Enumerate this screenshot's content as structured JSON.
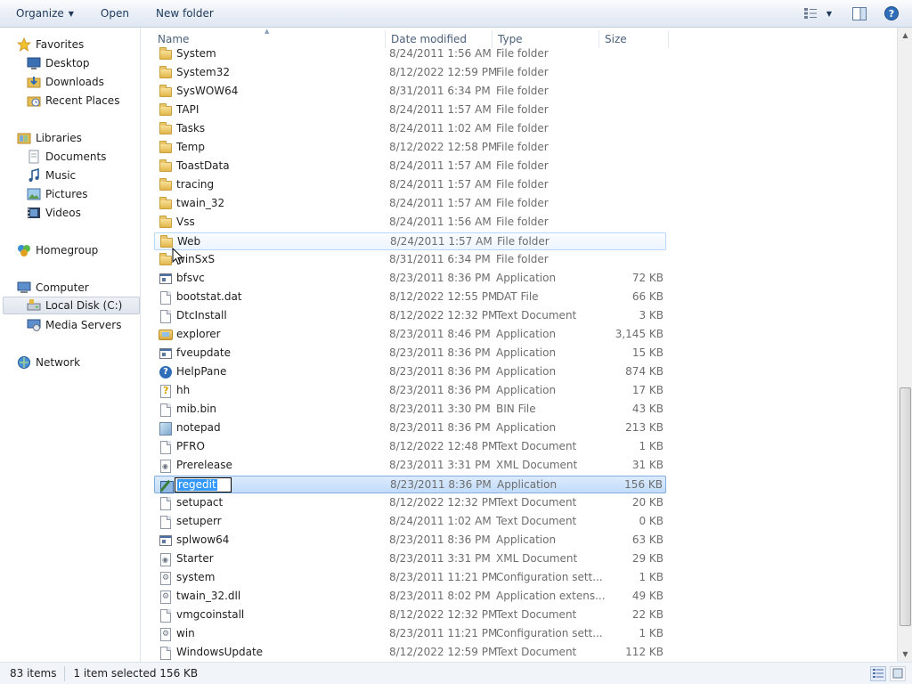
{
  "toolbar": {
    "organize_label": "Organize",
    "open_label": "Open",
    "new_folder_label": "New folder",
    "icons": [
      "views-icon",
      "chevron-down-icon",
      "preview-pane-icon",
      "help-icon"
    ]
  },
  "nav": {
    "favorites": "Favorites",
    "desktop": "Desktop",
    "downloads": "Downloads",
    "recent_places": "Recent Places",
    "libraries": "Libraries",
    "documents": "Documents",
    "music": "Music",
    "pictures": "Pictures",
    "videos": "Videos",
    "homegroup": "Homegroup",
    "computer": "Computer",
    "local_disk": "Local Disk (C:)",
    "media_servers": "Media Servers",
    "network": "Network"
  },
  "columns": {
    "name": "Name",
    "date_modified": "Date modified",
    "type": "Type",
    "size": "Size"
  },
  "rows": [
    {
      "name": "System",
      "date": "8/24/2011 1:56 AM",
      "type": "File folder",
      "size": "",
      "icon": "folder-icon"
    },
    {
      "name": "System32",
      "date": "8/12/2022 12:59 PM",
      "type": "File folder",
      "size": "",
      "icon": "folder-icon"
    },
    {
      "name": "SysWOW64",
      "date": "8/31/2011 6:34 PM",
      "type": "File folder",
      "size": "",
      "icon": "folder-icon"
    },
    {
      "name": "TAPI",
      "date": "8/24/2011 1:57 AM",
      "type": "File folder",
      "size": "",
      "icon": "folder-icon"
    },
    {
      "name": "Tasks",
      "date": "8/24/2011 1:02 AM",
      "type": "File folder",
      "size": "",
      "icon": "folder-icon"
    },
    {
      "name": "Temp",
      "date": "8/12/2022 12:58 PM",
      "type": "File folder",
      "size": "",
      "icon": "folder-icon"
    },
    {
      "name": "ToastData",
      "date": "8/24/2011 1:57 AM",
      "type": "File folder",
      "size": "",
      "icon": "folder-icon"
    },
    {
      "name": "tracing",
      "date": "8/24/2011 1:57 AM",
      "type": "File folder",
      "size": "",
      "icon": "folder-icon"
    },
    {
      "name": "twain_32",
      "date": "8/24/2011 1:57 AM",
      "type": "File folder",
      "size": "",
      "icon": "folder-icon"
    },
    {
      "name": "Vss",
      "date": "8/24/2011 1:56 AM",
      "type": "File folder",
      "size": "",
      "icon": "folder-icon"
    },
    {
      "name": "Web",
      "date": "8/24/2011 1:57 AM",
      "type": "File folder",
      "size": "",
      "icon": "folder-icon",
      "state": "hover"
    },
    {
      "name": "winSxS",
      "date": "8/31/2011 6:34 PM",
      "type": "File folder",
      "size": "",
      "icon": "folder-icon"
    },
    {
      "name": "bfsvc",
      "date": "8/23/2011 8:36 PM",
      "type": "Application",
      "size": "72 KB",
      "icon": "application-icon"
    },
    {
      "name": "bootstat.dat",
      "date": "8/12/2022 12:55 PM",
      "type": "DAT File",
      "size": "66 KB",
      "icon": "file-icon"
    },
    {
      "name": "DtcInstall",
      "date": "8/12/2022 12:32 PM",
      "type": "Text Document",
      "size": "3 KB",
      "icon": "text-file-icon"
    },
    {
      "name": "explorer",
      "date": "8/23/2011 8:46 PM",
      "type": "Application",
      "size": "3,145 KB",
      "icon": "explorer-icon"
    },
    {
      "name": "fveupdate",
      "date": "8/23/2011 8:36 PM",
      "type": "Application",
      "size": "15 KB",
      "icon": "application-icon"
    },
    {
      "name": "HelpPane",
      "date": "8/23/2011 8:36 PM",
      "type": "Application",
      "size": "874 KB",
      "icon": "help-icon"
    },
    {
      "name": "hh",
      "date": "8/23/2011 8:36 PM",
      "type": "Application",
      "size": "17 KB",
      "icon": "help-file-icon"
    },
    {
      "name": "mib.bin",
      "date": "8/23/2011 3:30 PM",
      "type": "BIN File",
      "size": "43 KB",
      "icon": "file-icon"
    },
    {
      "name": "notepad",
      "date": "8/23/2011 8:36 PM",
      "type": "Application",
      "size": "213 KB",
      "icon": "notepad-icon"
    },
    {
      "name": "PFRO",
      "date": "8/12/2022 12:48 PM",
      "type": "Text Document",
      "size": "1 KB",
      "icon": "text-file-icon"
    },
    {
      "name": "Prerelease",
      "date": "8/23/2011 3:31 PM",
      "type": "XML Document",
      "size": "31 KB",
      "icon": "xml-file-icon"
    },
    {
      "name": "regedit",
      "date": "8/23/2011 8:36 PM",
      "type": "Application",
      "size": "156 KB",
      "icon": "regedit-icon",
      "state": "selected-renaming"
    },
    {
      "name": "setupact",
      "date": "8/12/2022 12:32 PM",
      "type": "Text Document",
      "size": "20 KB",
      "icon": "text-file-icon"
    },
    {
      "name": "setuperr",
      "date": "8/24/2011 1:02 AM",
      "type": "Text Document",
      "size": "0 KB",
      "icon": "text-file-icon"
    },
    {
      "name": "splwow64",
      "date": "8/23/2011 8:36 PM",
      "type": "Application",
      "size": "63 KB",
      "icon": "application-icon"
    },
    {
      "name": "Starter",
      "date": "8/23/2011 3:31 PM",
      "type": "XML Document",
      "size": "29 KB",
      "icon": "xml-file-icon"
    },
    {
      "name": "system",
      "date": "8/23/2011 11:21 PM",
      "type": "Configuration sett...",
      "size": "1 KB",
      "icon": "config-file-icon"
    },
    {
      "name": "twain_32.dll",
      "date": "8/23/2011 8:02 PM",
      "type": "Application extens...",
      "size": "49 KB",
      "icon": "config-file-icon"
    },
    {
      "name": "vmgcoinstall",
      "date": "8/12/2022 12:32 PM",
      "type": "Text Document",
      "size": "22 KB",
      "icon": "text-file-icon"
    },
    {
      "name": "win",
      "date": "8/23/2011 11:21 PM",
      "type": "Configuration sett...",
      "size": "1 KB",
      "icon": "config-file-icon"
    },
    {
      "name": "WindowsUpdate",
      "date": "8/12/2022 12:59 PM",
      "type": "Text Document",
      "size": "112 KB",
      "icon": "text-file-icon"
    }
  ],
  "status": {
    "item_count": "83 items",
    "selection": "1 item selected  156 KB"
  }
}
